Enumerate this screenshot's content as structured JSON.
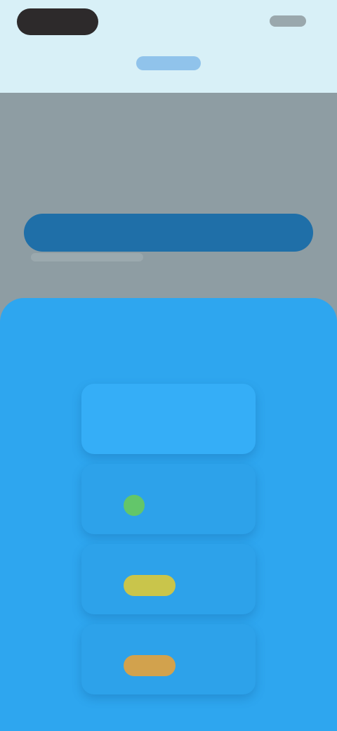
{
  "app": {
    "tab_label": "",
    "cta_label": ""
  },
  "sheet": {
    "title": "",
    "options": [
      {
        "label": "",
        "value": ""
      },
      {
        "label": "",
        "value": "",
        "swatch_color": "#63c66a"
      },
      {
        "label": "",
        "value": "",
        "swatch_color": "#c9c54b"
      },
      {
        "label": "",
        "value": "",
        "swatch_color": "#d2a24d"
      }
    ]
  },
  "colors": {
    "sheet_background": "#2ea6ef",
    "option_background": "#2da2ea",
    "cta_background": "#1f6fa8"
  }
}
